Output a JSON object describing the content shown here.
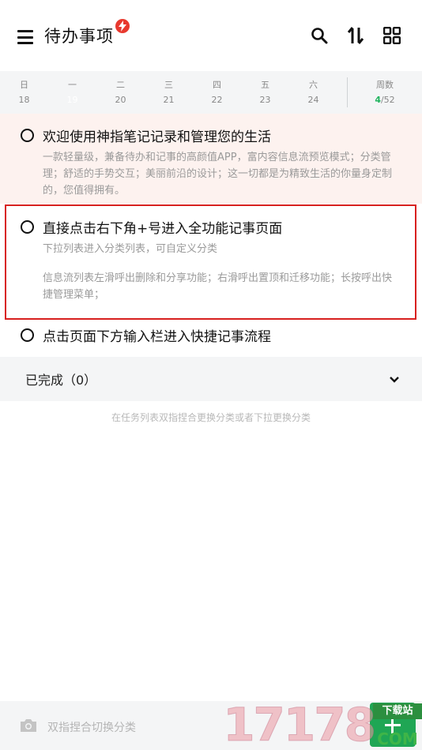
{
  "header": {
    "title": "待办事项",
    "icons": [
      "menu-icon",
      "flash-badge-icon",
      "search-icon",
      "sort-icon",
      "grid-icon"
    ]
  },
  "week": {
    "days": [
      {
        "name": "日",
        "date": "18"
      },
      {
        "name": "一",
        "date": "19"
      },
      {
        "name": "二",
        "date": "20"
      },
      {
        "name": "三",
        "date": "21"
      },
      {
        "name": "四",
        "date": "22"
      },
      {
        "name": "五",
        "date": "23"
      },
      {
        "name": "六",
        "date": "24"
      }
    ],
    "today_index": 1,
    "weeknum_label": "周数",
    "weeknum_current": "4",
    "weeknum_total": "/52"
  },
  "tasks": [
    {
      "title": "欢迎使用神指笔记记录和管理您的生活",
      "desc": "一款轻量级，兼备待办和记事的高颜值APP，富内容信息流预览模式；分类管理；舒适的手势交互；美丽前沿的设计；这一切都是为精致生活的你量身定制的，您值得拥有。"
    },
    {
      "title": "直接点击右下角+号进入全功能记事页面",
      "desc1": "下拉列表进入分类列表，可自定义分类",
      "desc2": "信息流列表左滑呼出删除和分享功能；右滑呼出置顶和迁移功能；长按呼出快捷管理菜单；"
    },
    {
      "title": "点击页面下方输入栏进入快捷记事流程"
    }
  ],
  "completed": {
    "label": "已完成（0）"
  },
  "hint": "在任务列表双指捏合更换分类或者下拉更换分类",
  "bottom": {
    "placeholder": "双指捏合切换分类"
  },
  "watermark": {
    "digits": "17178",
    "badge_top": "下载站",
    "badge_bottom": "COM"
  },
  "colors": {
    "accent_green": "#20b45e",
    "highlight_red": "#d8201f",
    "badge_red": "#e8392f"
  }
}
